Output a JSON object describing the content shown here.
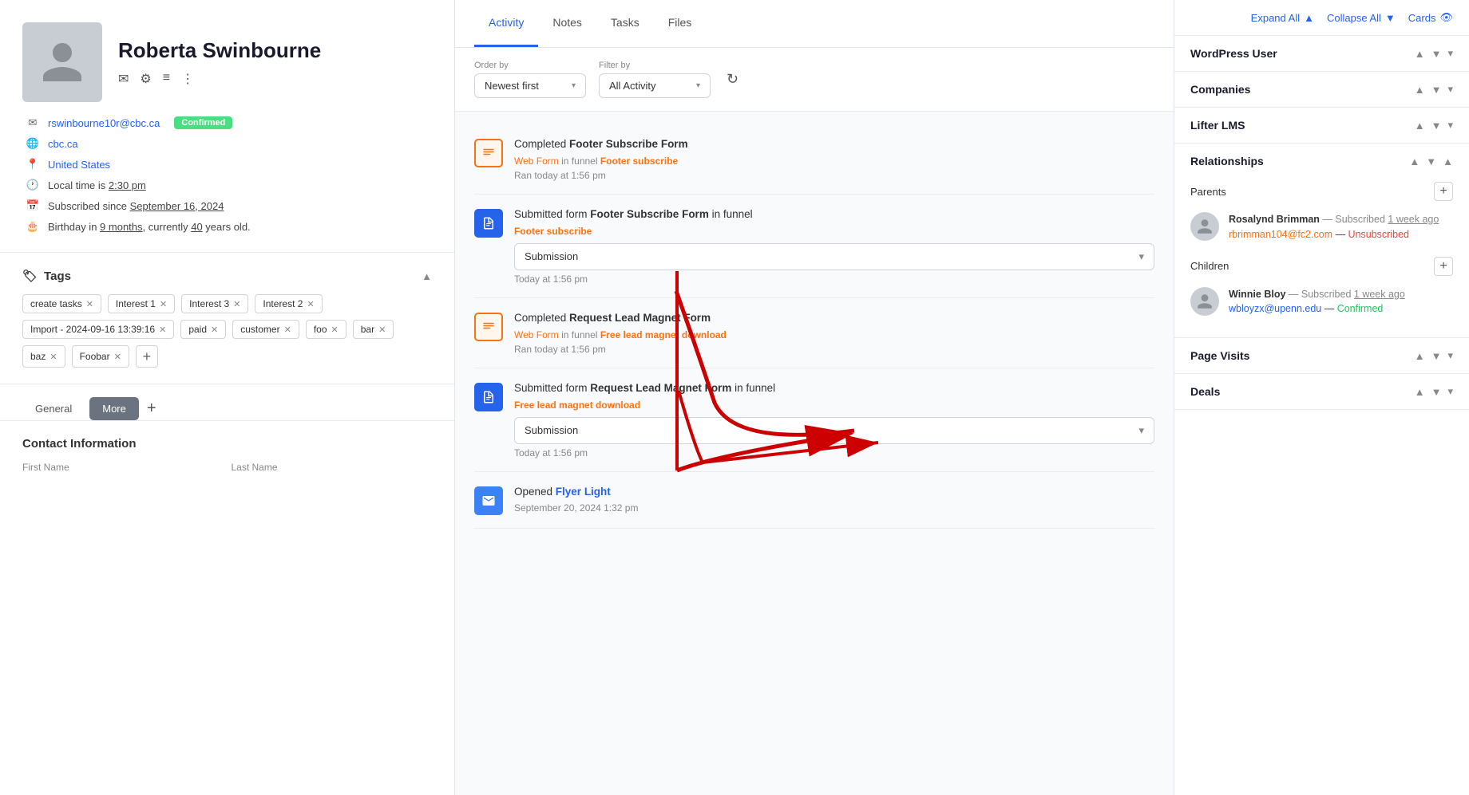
{
  "profile": {
    "name": "Roberta Swinbourne",
    "email": "rswinbourne10r@cbc.ca",
    "email_status": "Confirmed",
    "website": "cbc.ca",
    "location": "United States",
    "local_time": "Local time is 2:30 pm",
    "subscribed_since": "Subscribed since September 16, 2024",
    "birthday": "Birthday in 9 months, currently 40 years old."
  },
  "tags": {
    "title": "Tags",
    "items": [
      {
        "label": "create tasks",
        "removable": true
      },
      {
        "label": "Interest 1",
        "removable": true
      },
      {
        "label": "Interest 3",
        "removable": true
      },
      {
        "label": "Interest 2",
        "removable": true
      },
      {
        "label": "Import - 2024-09-16 13:39:16",
        "removable": true
      },
      {
        "label": "paid",
        "removable": true
      },
      {
        "label": "customer",
        "removable": true
      },
      {
        "label": "foo",
        "removable": true
      },
      {
        "label": "bar",
        "removable": true
      },
      {
        "label": "baz",
        "removable": true
      },
      {
        "label": "Foobar",
        "removable": true
      }
    ]
  },
  "bottom_tabs": {
    "active": "More",
    "tabs": [
      "General",
      "More"
    ],
    "add_label": "+"
  },
  "contact_section": {
    "title": "Contact Information",
    "fields": [
      {
        "label": "First Name",
        "value": ""
      },
      {
        "label": "Last Name",
        "value": ""
      }
    ]
  },
  "middle": {
    "tabs": [
      {
        "label": "Activity",
        "active": true
      },
      {
        "label": "Notes",
        "active": false
      },
      {
        "label": "Tasks",
        "active": false
      },
      {
        "label": "Files",
        "active": false
      }
    ],
    "filter": {
      "order_by_label": "Order by",
      "order_by_value": "Newest first",
      "filter_by_label": "Filter by",
      "filter_by_value": "All Activity"
    },
    "activities": [
      {
        "id": 1,
        "icon_type": "orange",
        "icon": "list",
        "title_prefix": "Completed ",
        "title_bold": "Footer Subscribe Form",
        "meta_type": "Web Form",
        "meta_text": " in funnel ",
        "meta_link": "Footer subscribe",
        "time": "Ran today at 1:56 pm",
        "has_dropdown": false
      },
      {
        "id": 2,
        "icon_type": "blue",
        "icon": "doc",
        "title_prefix": "Submitted form ",
        "title_bold": "Footer Subscribe Form",
        "title_suffix": " in funnel",
        "meta_link_standalone": "Footer subscribe",
        "time": "Today at 1:56 pm",
        "has_dropdown": true,
        "dropdown_label": "Submission"
      },
      {
        "id": 3,
        "icon_type": "orange",
        "icon": "list",
        "title_prefix": "Completed ",
        "title_bold": "Request Lead Magnet Form",
        "meta_type": "Web Form",
        "meta_text": " in funnel ",
        "meta_link": "Free lead magnet download",
        "time": "Ran today at 1:56 pm",
        "has_dropdown": false
      },
      {
        "id": 4,
        "icon_type": "blue",
        "icon": "doc",
        "title_prefix": "Submitted form ",
        "title_bold": "Request Lead Magnet Form",
        "title_suffix": " in funnel",
        "meta_link_standalone": "Free lead magnet download",
        "time": "Today at 1:56 pm",
        "has_dropdown": true,
        "dropdown_label": "Submission"
      },
      {
        "id": 5,
        "icon_type": "blue-light",
        "icon": "email",
        "title_prefix": "Opened ",
        "title_link": "Flyer Light",
        "time": "September 20, 2024 1:32 pm",
        "has_dropdown": false
      }
    ]
  },
  "right": {
    "top_actions": [
      {
        "label": "Expand All",
        "arrow": "▲"
      },
      {
        "label": "Collapse All",
        "arrow": "▼"
      },
      {
        "label": "Cards",
        "icon": "eye"
      }
    ],
    "sections": [
      {
        "title": "WordPress User",
        "expanded": true,
        "has_content": false
      },
      {
        "title": "Companies",
        "expanded": true,
        "has_content": false
      },
      {
        "title": "Lifter LMS",
        "expanded": true,
        "has_content": false
      },
      {
        "title": "Relationships",
        "expanded": true,
        "has_content": true,
        "subsections": [
          {
            "label": "Parents",
            "people": [
              {
                "name": "Rosalynd Brimman",
                "meta": "— Subscribed 1 week ago",
                "email": "rbrimman104@fc2.com",
                "status": "Unsubscribed",
                "status_type": "unsubscribed"
              }
            ]
          },
          {
            "label": "Children",
            "people": [
              {
                "name": "Winnie Bloy",
                "meta": "— Subscribed 1 week ago",
                "email": "wbloyzx@upenn.edu",
                "status": "Confirmed",
                "status_type": "confirmed"
              }
            ]
          }
        ]
      },
      {
        "title": "Page Visits",
        "expanded": true,
        "has_content": false
      },
      {
        "title": "Deals",
        "expanded": true,
        "has_content": false
      }
    ]
  }
}
